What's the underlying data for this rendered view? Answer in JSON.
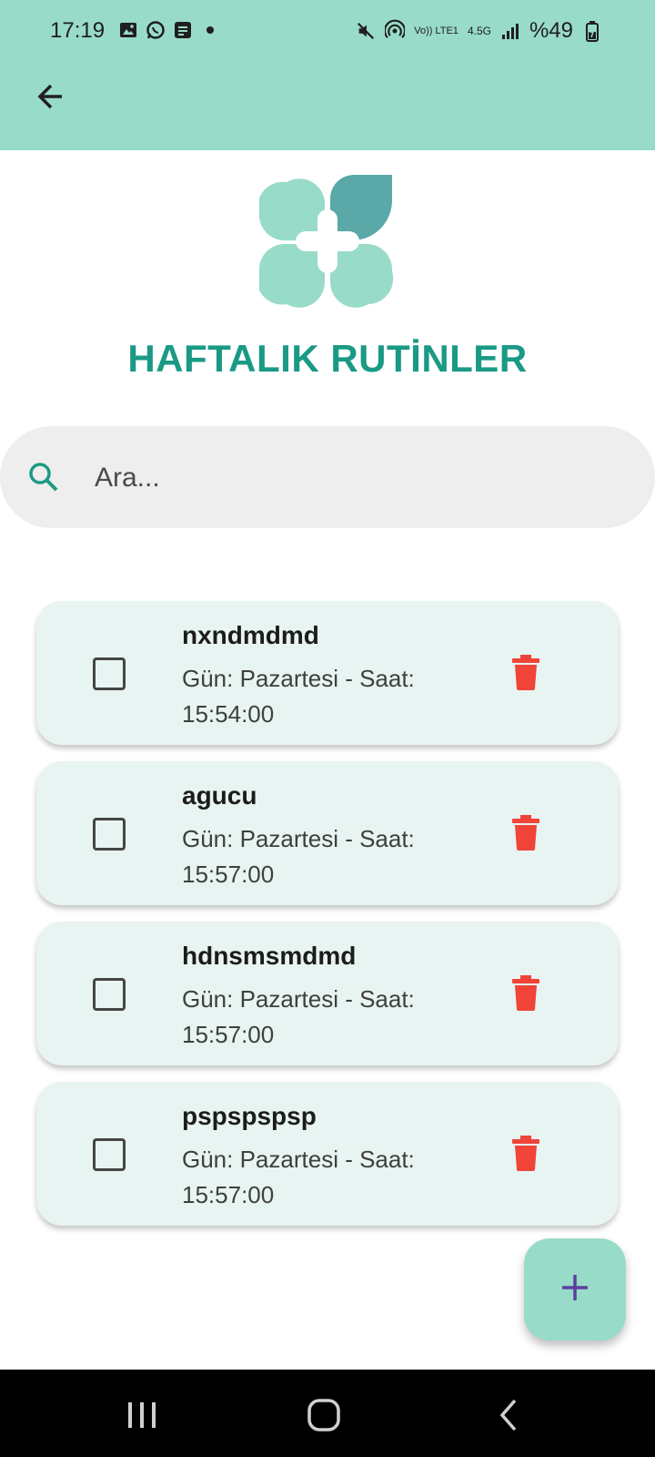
{
  "status_bar": {
    "time": "17:19",
    "battery": "%49",
    "network": "4.5G",
    "volte": "Vo)) LTE1",
    "left_icons": [
      "image-icon",
      "whatsapp-icon",
      "message-icon",
      "dot-icon"
    ],
    "right_icons": [
      "mute-icon",
      "hotspot-icon",
      "signal-icon",
      "battery-icon"
    ]
  },
  "app_bar": {
    "back_icon": "arrow-left-icon"
  },
  "page": {
    "title": "HAFTALIK RUTİNLER",
    "logo": "clover-cross-logo"
  },
  "search": {
    "placeholder": "Ara...",
    "value": "",
    "icon": "search-icon"
  },
  "routines": [
    {
      "title": "nxndmdmd",
      "subtitle": "Gün: Pazartesi - Saat: 15:54:00",
      "checked": false
    },
    {
      "title": "agucu",
      "subtitle": "Gün: Pazartesi - Saat: 15:57:00",
      "checked": false
    },
    {
      "title": "hdnsmsmdmd",
      "subtitle": "Gün: Pazartesi - Saat: 15:57:00",
      "checked": false
    },
    {
      "title": "pspspspsp",
      "subtitle": "Gün: Pazartesi - Saat: 15:57:00",
      "checked": false
    }
  ],
  "fab": {
    "icon": "plus-icon"
  },
  "nav_bar": {
    "items": [
      "recents-icon",
      "home-icon",
      "back-icon"
    ]
  },
  "colors": {
    "appbar": "#98dbc8",
    "title": "#1a9a85",
    "card": "#e7f4f2",
    "delete": "#f04438",
    "fab_plus": "#5b3fa0"
  }
}
